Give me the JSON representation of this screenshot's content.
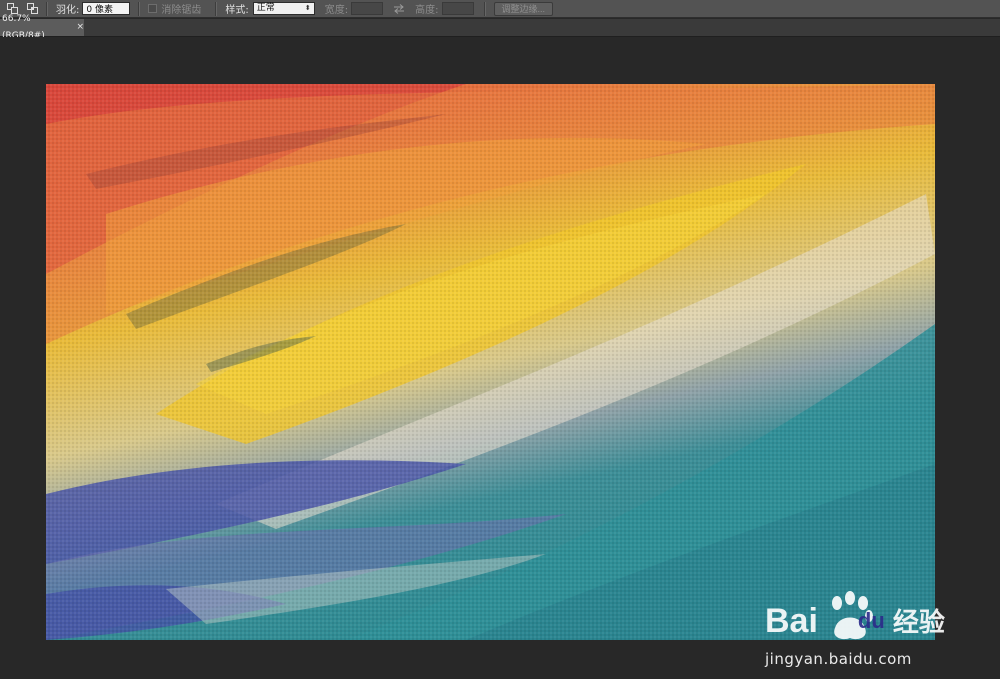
{
  "options_bar": {
    "feather_label": "羽化:",
    "feather_value": "0 像素",
    "antialias_label": "消除锯齿",
    "style_label": "样式:",
    "style_value": "正常",
    "width_label": "宽度:",
    "height_label": "高度:",
    "refine_edge_label": "调整边缘..."
  },
  "document_tab": {
    "title": "66.7%(RGB/8#)",
    "close_glyph": "×"
  },
  "watermark": {
    "brand_latin_1": "Bai",
    "brand_latin_2": "du",
    "brand_cn": "经验",
    "url": "jingyan.baidu.com"
  },
  "colors": {
    "workspace": "#282828",
    "options_bar": "#535353",
    "tab_active": "#5c5c5c"
  }
}
